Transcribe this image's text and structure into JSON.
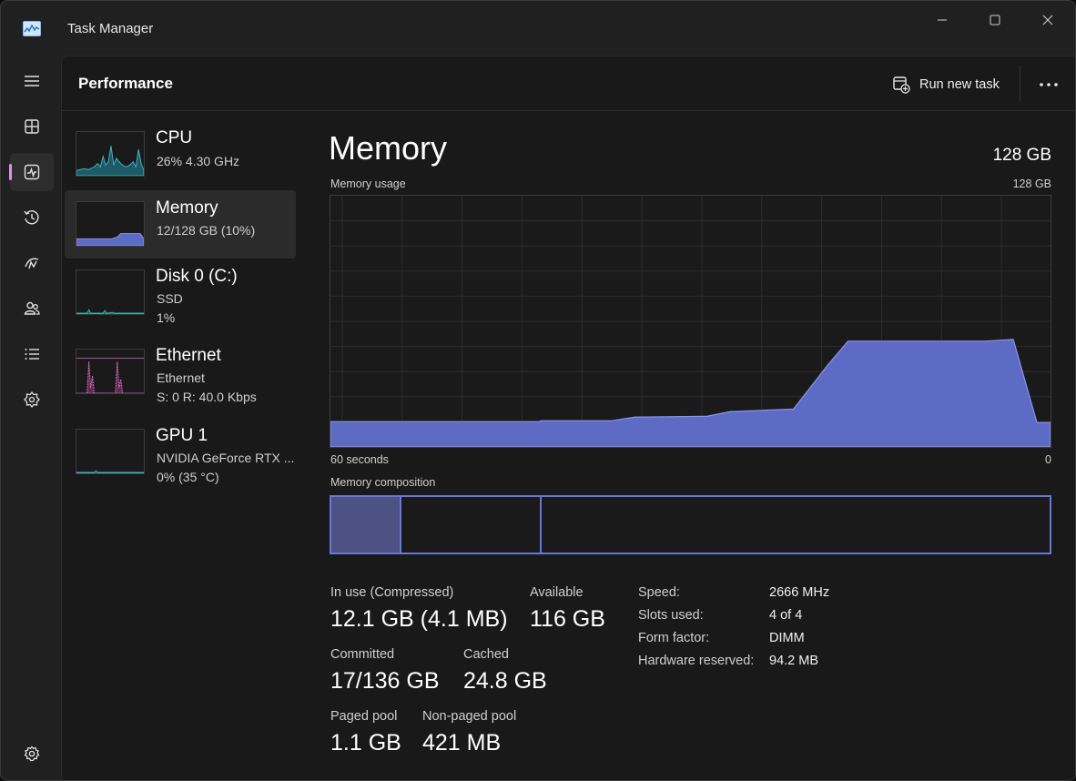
{
  "window": {
    "title": "Task Manager"
  },
  "nav": {
    "items": [
      {
        "name": "hamburger-menu-icon",
        "label": "Menu"
      },
      {
        "name": "processes-icon",
        "label": "Processes"
      },
      {
        "name": "performance-icon",
        "label": "Performance",
        "active": true
      },
      {
        "name": "app-history-icon",
        "label": "App history"
      },
      {
        "name": "startup-apps-icon",
        "label": "Startup apps"
      },
      {
        "name": "users-icon",
        "label": "Users"
      },
      {
        "name": "details-icon",
        "label": "Details"
      },
      {
        "name": "services-icon",
        "label": "Services"
      }
    ],
    "settings_icon": "gear-icon"
  },
  "header": {
    "page_title": "Performance",
    "run_new_task": "Run new task",
    "more_icon": "ellipsis-icon"
  },
  "devices": [
    {
      "name": "CPU",
      "line1": "26%  4.30 GHz",
      "color": "#3fb6c7"
    },
    {
      "name": "Memory",
      "line1": "12/128 GB (10%)",
      "color": "#6a76d8",
      "selected": true
    },
    {
      "name": "Disk 0 (C:)",
      "line1": "SSD",
      "line2": "1%",
      "color": "#2fb39a"
    },
    {
      "name": "Ethernet",
      "line1": "Ethernet",
      "line2": "S: 0  R: 40.0 Kbps",
      "color": "#d96fbf"
    },
    {
      "name": "GPU 1",
      "line1": "NVIDIA GeForce RTX ...",
      "line2": "0%  (35 °C)",
      "color": "#3fb6c7"
    }
  ],
  "memory": {
    "title": "Memory",
    "total": "128 GB",
    "usage_label": "Memory usage",
    "usage_max": "128 GB",
    "time_left": "60 seconds",
    "time_right": "0",
    "composition_label": "Memory composition",
    "accent": "#6a76d8",
    "usage_fill": "#5e6bc4"
  },
  "stats": {
    "in_use_label": "In use (Compressed)",
    "in_use_value": "12.1 GB (4.1 MB)",
    "available_label": "Available",
    "available_value": "116 GB",
    "committed_label": "Committed",
    "committed_value": "17/136 GB",
    "cached_label": "Cached",
    "cached_value": "24.8 GB",
    "paged_label": "Paged pool",
    "paged_value": "1.1 GB",
    "nonpaged_label": "Non-paged pool",
    "nonpaged_value": "421 MB"
  },
  "specs": [
    {
      "label": "Speed:",
      "value": "2666 MHz"
    },
    {
      "label": "Slots used:",
      "value": "4 of 4"
    },
    {
      "label": "Form factor:",
      "value": "DIMM"
    },
    {
      "label": "Hardware reserved:",
      "value": "94.2 MB"
    }
  ]
}
